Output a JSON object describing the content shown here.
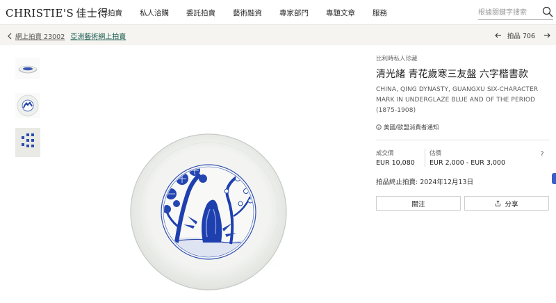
{
  "header": {
    "logo_text": "CHRISTIE'S",
    "logo_cn": "佳士得",
    "nav": [
      "拍賣",
      "私人洽購",
      "委託拍賣",
      "藝術融資",
      "專家部門",
      "專題文章",
      "服務"
    ],
    "search_placeholder": "根據關鍵字搜索"
  },
  "breadcrumb": {
    "sale_link": "網上拍賣 23002",
    "category_link": "亞洲藝術網上拍賣",
    "lot_label": "拍品 706"
  },
  "thumbnails": [
    "dish-side-view",
    "dish-top-view",
    "reign-mark"
  ],
  "lot": {
    "collection": "比利時私人珍藏",
    "title_cn": "清光緒 青花歲寒三友盤 六字楷書款",
    "title_en": "CHINA, QING DYNASTY, GUANGXU SIX-CHARACTER MARK IN UNDERGLAZE BLUE AND OF THE PERIOD (1875-1908)",
    "notice": "美國/歐盟消費者通知",
    "price_realised_label": "成交價",
    "price_realised": "EUR 10,080",
    "estimate_label": "估價",
    "estimate": "EUR 2,000 - EUR 3,000",
    "closing": "拍品終止拍賣: 2024年12月13日",
    "follow_label": "關注",
    "share_label": "分享"
  },
  "colors": {
    "accent_green": "#1f5f53",
    "crumb_bg": "#f5f4f0",
    "porcelain_blue": "#1e3fae",
    "side_tab": "#3a5fc8"
  }
}
